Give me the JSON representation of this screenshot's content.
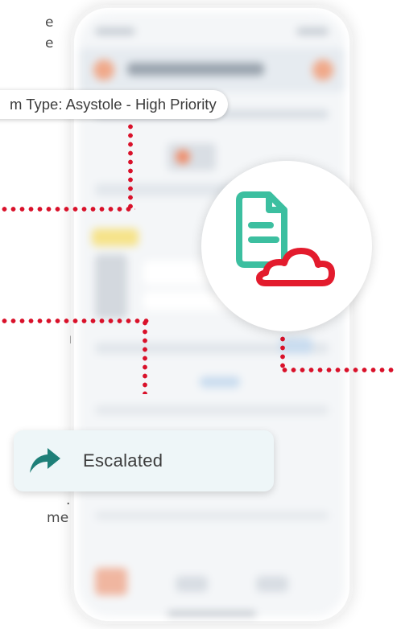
{
  "left_text": {
    "line1": "e",
    "line2": "e",
    "line3": "n –",
    "line4": ".",
    "line5": "me"
  },
  "alarm_callout": {
    "text": "m Type: Asystole - High Priority"
  },
  "escalated_callout": {
    "label": "Escalated",
    "icon": "forward-arrow-icon"
  },
  "badge": {
    "icon": "document-cloud-icon"
  },
  "colors": {
    "connector": "#d9112a",
    "document": "#3cbfa0",
    "cloud": "#e31b2d",
    "arrow": "#1e7f78"
  }
}
